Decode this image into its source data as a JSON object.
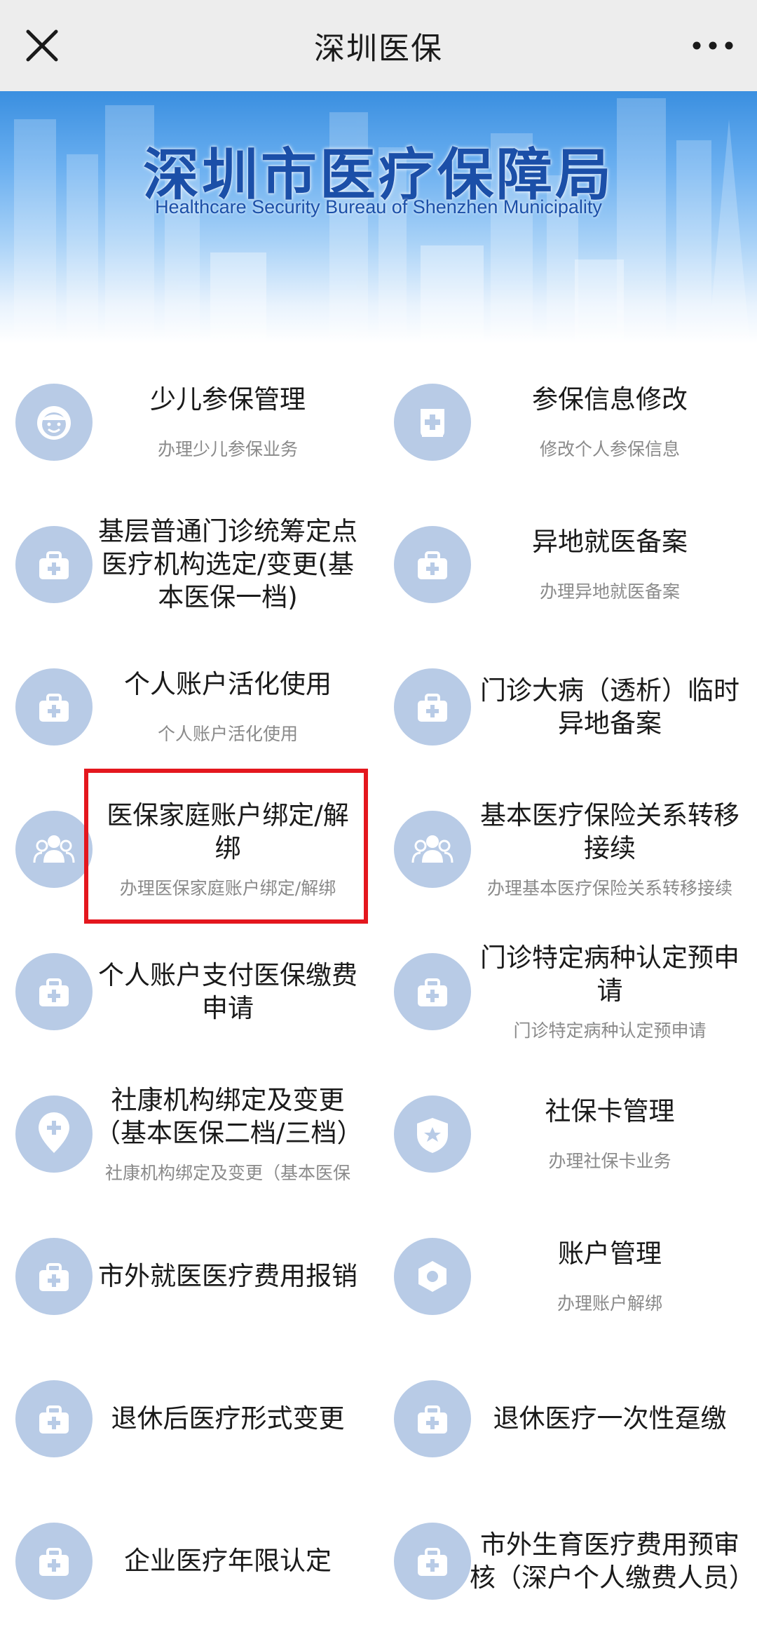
{
  "header": {
    "title": "深圳医保",
    "close_icon": "close-icon",
    "more_icon": "more-dots-icon"
  },
  "banner": {
    "title_cn": "深圳市医疗保障局",
    "title_en": "Healthcare Security Bureau of Shenzhen Municipality"
  },
  "services": [
    {
      "name": "少儿参保管理",
      "desc": "办理少儿参保业务",
      "icon": "child-face-icon"
    },
    {
      "name": "参保信息修改",
      "desc": "修改个人参保信息",
      "icon": "id-card-icon"
    },
    {
      "name": "基层普通门诊统筹定点医疗机构选定/变更(基本医保一档)",
      "desc": "",
      "icon": "medical-kit-icon"
    },
    {
      "name": "异地就医备案",
      "desc": "办理异地就医备案",
      "icon": "medical-kit-icon"
    },
    {
      "name": "个人账户活化使用",
      "desc": "个人账户活化使用",
      "icon": "medical-kit-icon"
    },
    {
      "name": "门诊大病（透析）临时异地备案",
      "desc": "",
      "icon": "medical-kit-icon"
    },
    {
      "name": "医保家庭账户绑定/解绑",
      "desc": "办理医保家庭账户绑定/解绑",
      "icon": "family-icon"
    },
    {
      "name": "基本医疗保险关系转移接续",
      "desc": "办理基本医疗保险关系转移接续",
      "icon": "family-icon"
    },
    {
      "name": "个人账户支付医保缴费申请",
      "desc": "",
      "icon": "medical-kit-icon"
    },
    {
      "name": "门诊特定病种认定预申请",
      "desc": "门诊特定病种认定预申请",
      "icon": "medical-kit-icon"
    },
    {
      "name": "社康机构绑定及变更（基本医保二档/三档）",
      "desc": "社康机构绑定及变更（基本医保",
      "icon": "location-plus-icon"
    },
    {
      "name": "社保卡管理",
      "desc": "办理社保卡业务",
      "icon": "shield-star-icon"
    },
    {
      "name": "市外就医医疗费用报销",
      "desc": "",
      "icon": "medical-kit-icon"
    },
    {
      "name": "账户管理",
      "desc": "办理账户解绑",
      "icon": "hexagon-nut-icon"
    },
    {
      "name": "退休后医疗形式变更",
      "desc": "",
      "icon": "medical-kit-icon"
    },
    {
      "name": "退休医疗一次性趸缴",
      "desc": "",
      "icon": "medical-kit-icon"
    },
    {
      "name": "企业医疗年限认定",
      "desc": "",
      "icon": "medical-kit-icon"
    },
    {
      "name": "市外生育医疗费用预审核（深户个人缴费人员）",
      "desc": "",
      "icon": "medical-kit-icon"
    }
  ],
  "highlight_color": "#e4171e",
  "icon_color": "#b8cbe6"
}
